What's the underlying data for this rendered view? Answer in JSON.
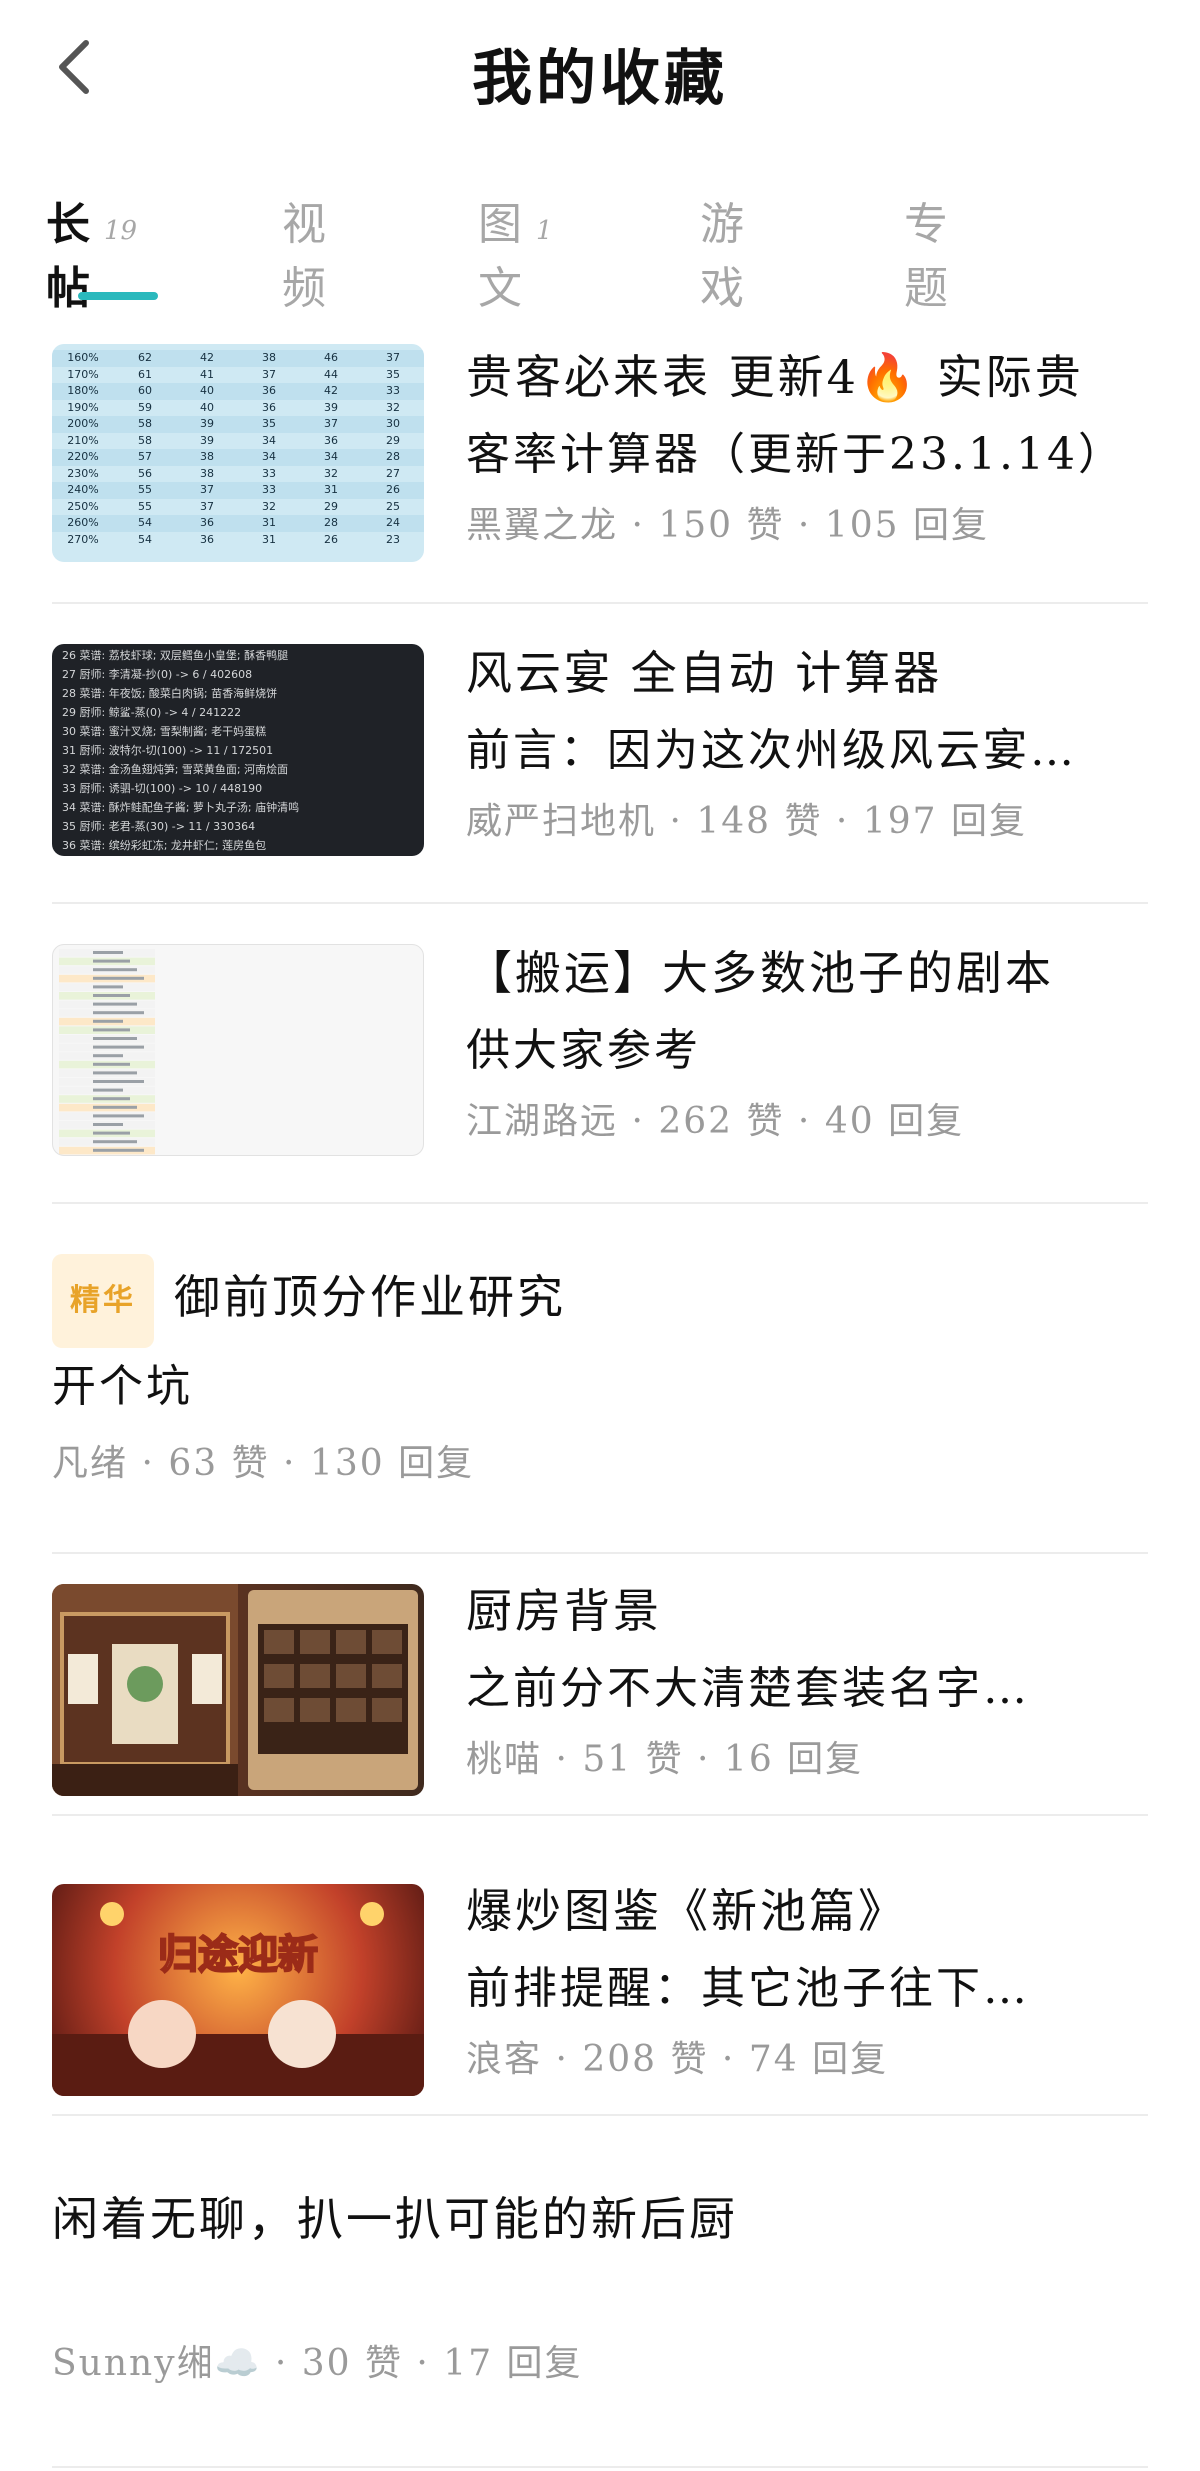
{
  "header": {
    "title": "我的收藏"
  },
  "tabs": [
    {
      "label": "长帖",
      "count": "19"
    },
    {
      "label": "视频",
      "count": ""
    },
    {
      "label": "图文",
      "count": "1"
    },
    {
      "label": "游戏",
      "count": ""
    },
    {
      "label": "专题",
      "count": ""
    }
  ],
  "items": [
    {
      "title": "贵客必来表 更新4🔥 实际贵",
      "excerpt": "客率计算器（更新于23.1.14）",
      "meta": "黑翼之龙 · 150 赞 · 105 回复",
      "thumb_table": [
        [
          "160%",
          "62",
          "42",
          "38",
          "46",
          "37"
        ],
        [
          "170%",
          "61",
          "41",
          "37",
          "44",
          "35"
        ],
        [
          "180%",
          "60",
          "40",
          "36",
          "42",
          "33"
        ],
        [
          "190%",
          "59",
          "40",
          "36",
          "39",
          "32"
        ],
        [
          "200%",
          "58",
          "39",
          "35",
          "37",
          "30"
        ],
        [
          "210%",
          "58",
          "39",
          "34",
          "36",
          "29"
        ],
        [
          "220%",
          "57",
          "38",
          "34",
          "34",
          "28"
        ],
        [
          "230%",
          "56",
          "38",
          "33",
          "32",
          "27"
        ],
        [
          "240%",
          "55",
          "37",
          "33",
          "31",
          "26"
        ],
        [
          "250%",
          "55",
          "37",
          "32",
          "29",
          "25"
        ],
        [
          "260%",
          "54",
          "36",
          "31",
          "28",
          "24"
        ],
        [
          "270%",
          "54",
          "36",
          "31",
          "26",
          "23"
        ]
      ]
    },
    {
      "title": "风云宴 全自动 计算器",
      "excerpt": "前言：因为这次州级风云宴…",
      "meta": "威严扫地机 · 148 赞 · 197 回复",
      "thumb_lines": [
        "26  菜谱: 荔枝虾球; 双层鳕鱼小皇堡; 酥香鸭腿",
        "27  厨师: 李清凝-抄(0) -> 6 / 402608",
        "28  菜谱: 年夜饭; 酸菜白肉锅; 苗香海鲜烧饼",
        "29  厨师: 鲸鲨-蒸(0) -> 4 / 241222",
        "30  菜谱: 蜜汁叉烧; 雪梨制酱; 老干妈蛋糕",
        "31  厨师: 波特尔-切(100) -> 11 / 172501",
        "32  菜谱: 金汤鱼翅炖笋; 雪菜黄鱼面; 河南烩面",
        "33  厨师: 诱驷-切(100) -> 10 / 448190",
        "34  菜谱: 酥炸鲑配鱼子酱; 萝卜丸子汤; 庙钟清鸣",
        "35  厨师: 老君-蒸(30) -> 11 / 330364",
        "36  菜谱: 缤纷彩虹冻; 龙井虾仁; 莲房鱼包"
      ]
    },
    {
      "title": "【搬运】大多数池子的剧本",
      "excerpt": "供大家参考",
      "meta": "江湖路远 · 262 赞 · 40 回复"
    },
    {
      "badge": "精华",
      "title": "御前顶分作业研究",
      "excerpt": "开个坑",
      "meta": "凡绪 · 63 赞 · 130 回复"
    },
    {
      "title": "厨房背景",
      "excerpt": "之前分不大清楚套装名字…",
      "meta": "桃喵 · 51 赞 · 16 回复"
    },
    {
      "title": "爆炒图鉴《新池篇》",
      "excerpt": "前排提醒：其它池子往下…",
      "meta": "浪客 · 208 赞 · 74 回复",
      "thumb_text": "归途迎新"
    },
    {
      "title": "闲着无聊，扒一扒可能的新后厨",
      "meta": "Sunny缃☁️ · 30 赞 · 17 回复"
    }
  ],
  "colors": {
    "accent": "#2ab9bd",
    "badge_bg": "#fff2db",
    "badge_fg": "#e8a329"
  },
  "icons": {
    "back": "chevron-left-icon"
  }
}
